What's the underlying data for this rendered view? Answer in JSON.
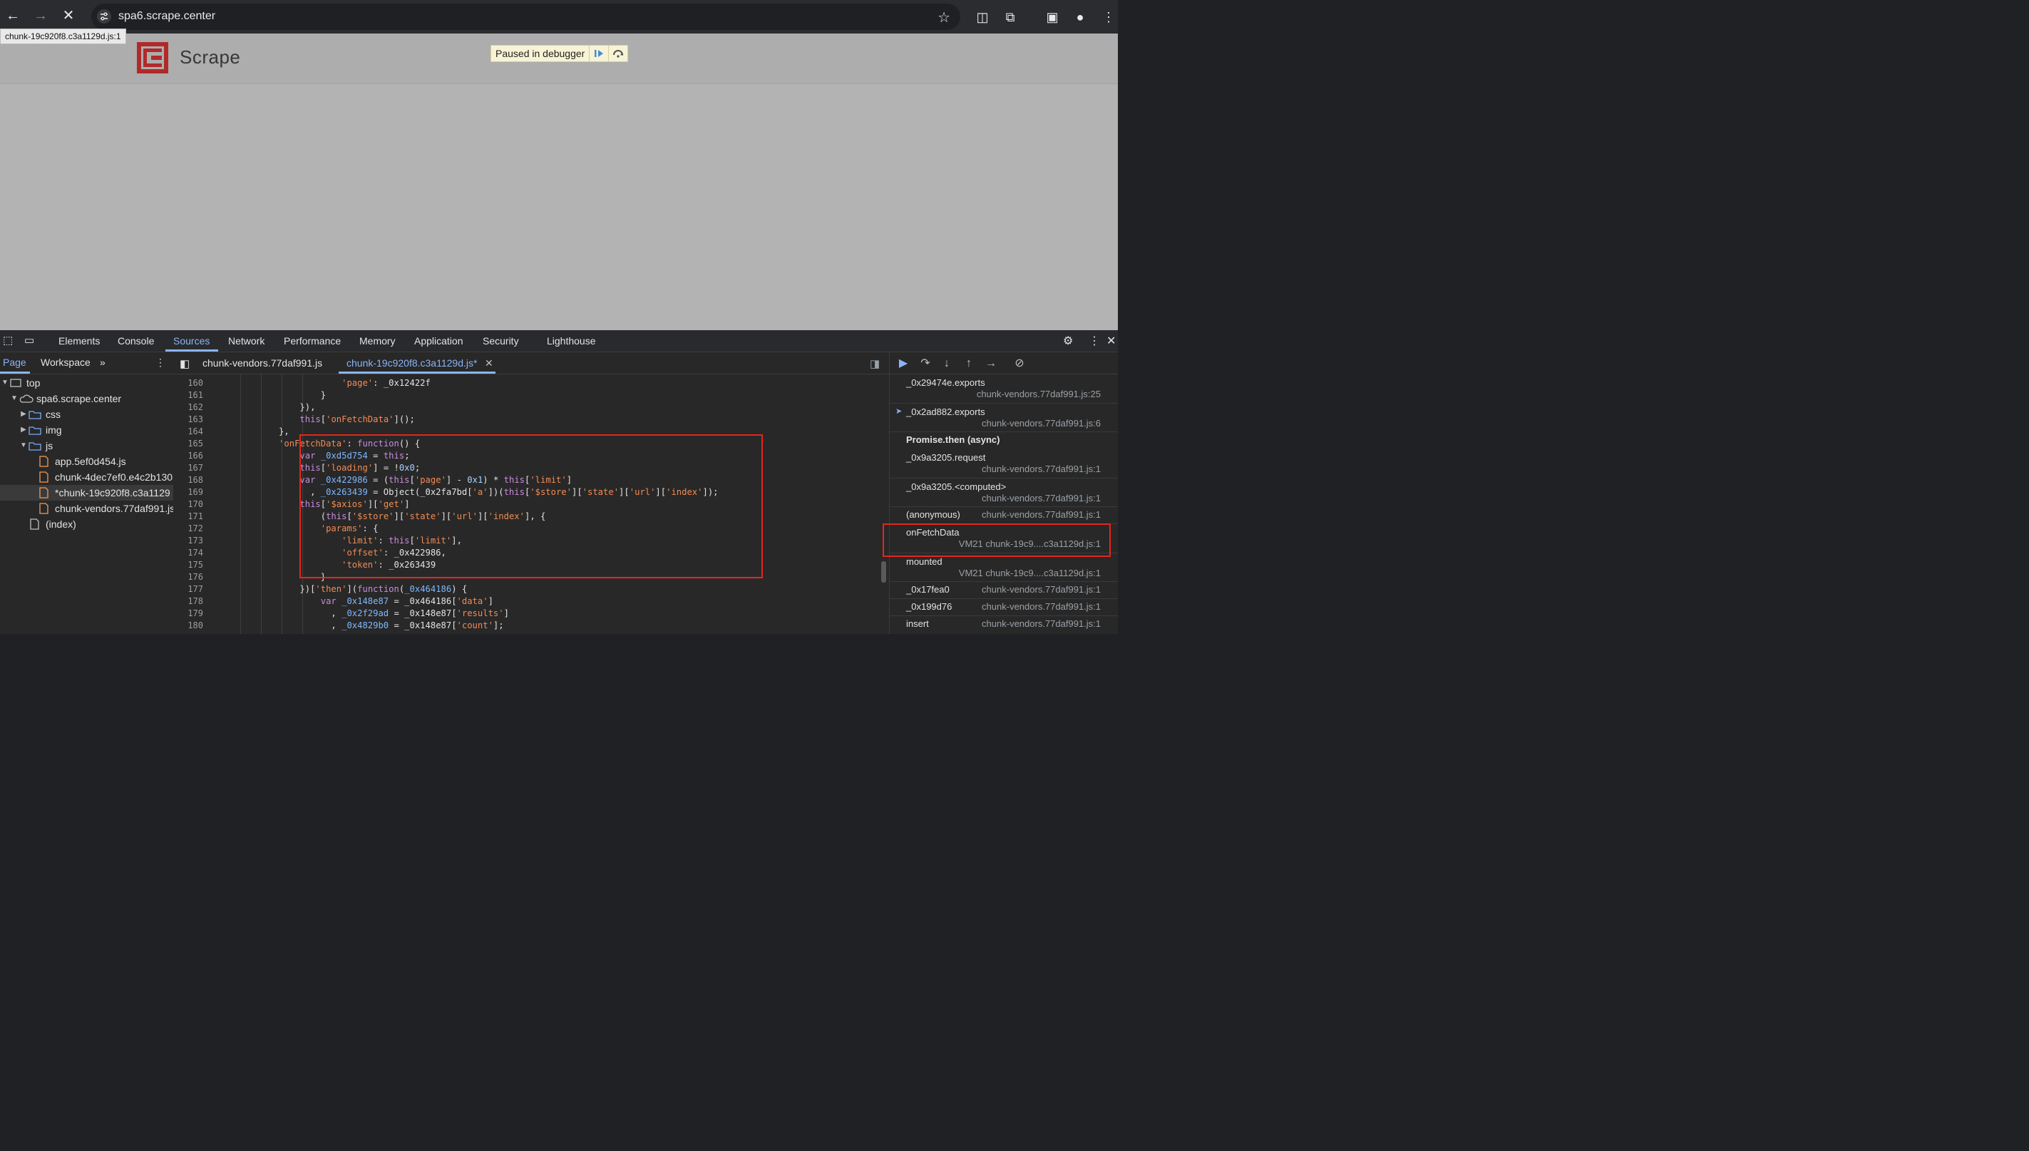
{
  "browser": {
    "url": "spa6.scrape.center",
    "tooltip": "chunk-19c920f8.c3a1129d.js:1"
  },
  "page": {
    "brand": "Scrape",
    "debugger_banner": "Paused in debugger"
  },
  "devtools": {
    "tabs": [
      "Elements",
      "Console",
      "Sources",
      "Network",
      "Performance",
      "Memory",
      "Application",
      "Security",
      "Lighthouse"
    ],
    "active_tab": "Sources",
    "nav_tabs": [
      "Page",
      "Workspace"
    ],
    "tree": [
      "top",
      "spa6.scrape.center",
      "css",
      "img",
      "js",
      "app.5ef0d454.js",
      "chunk-4dec7ef0.e4c2b130",
      "*chunk-19c920f8.c3a1129",
      "chunk-vendors.77daf991.js",
      "(index)"
    ],
    "editor_tabs": [
      "chunk-vendors.77daf991.js",
      "chunk-19c920f8.c3a1129d.js*"
    ],
    "line_numbers": [
      "160",
      "161",
      "162",
      "163",
      "164",
      "165",
      "166",
      "167",
      "168",
      "169",
      "170",
      "171",
      "172",
      "173",
      "174",
      "175",
      "176",
      "177",
      "178",
      "179",
      "180"
    ],
    "call_stack": [
      {
        "fn": "_0x29474e.exports",
        "loc": "chunk-vendors.77daf991.js:25"
      },
      {
        "fn": "_0x2ad882.exports",
        "loc": "chunk-vendors.77daf991.js:6"
      },
      {
        "fn": "Promise.then (async)",
        "loc": ""
      },
      {
        "fn": "_0x9a3205.request",
        "loc": "chunk-vendors.77daf991.js:1"
      },
      {
        "fn": "_0x9a3205.<computed>",
        "loc": "chunk-vendors.77daf991.js:1"
      },
      {
        "fn": "(anonymous)",
        "loc": "chunk-vendors.77daf991.js:1"
      },
      {
        "fn": "onFetchData",
        "loc": "VM21 chunk-19c9....c3a1129d.js:1"
      },
      {
        "fn": "mounted",
        "loc": "VM21 chunk-19c9....c3a1129d.js:1"
      },
      {
        "fn": "_0x17fea0",
        "loc": "chunk-vendors.77daf991.js:1"
      },
      {
        "fn": "_0x199d76",
        "loc": "chunk-vendors.77daf991.js:1"
      },
      {
        "fn": "insert",
        "loc": "chunk-vendors.77daf991.js:1"
      }
    ],
    "colors": {
      "accent": "#8ab4f8",
      "highlight": "#e5261c"
    }
  }
}
